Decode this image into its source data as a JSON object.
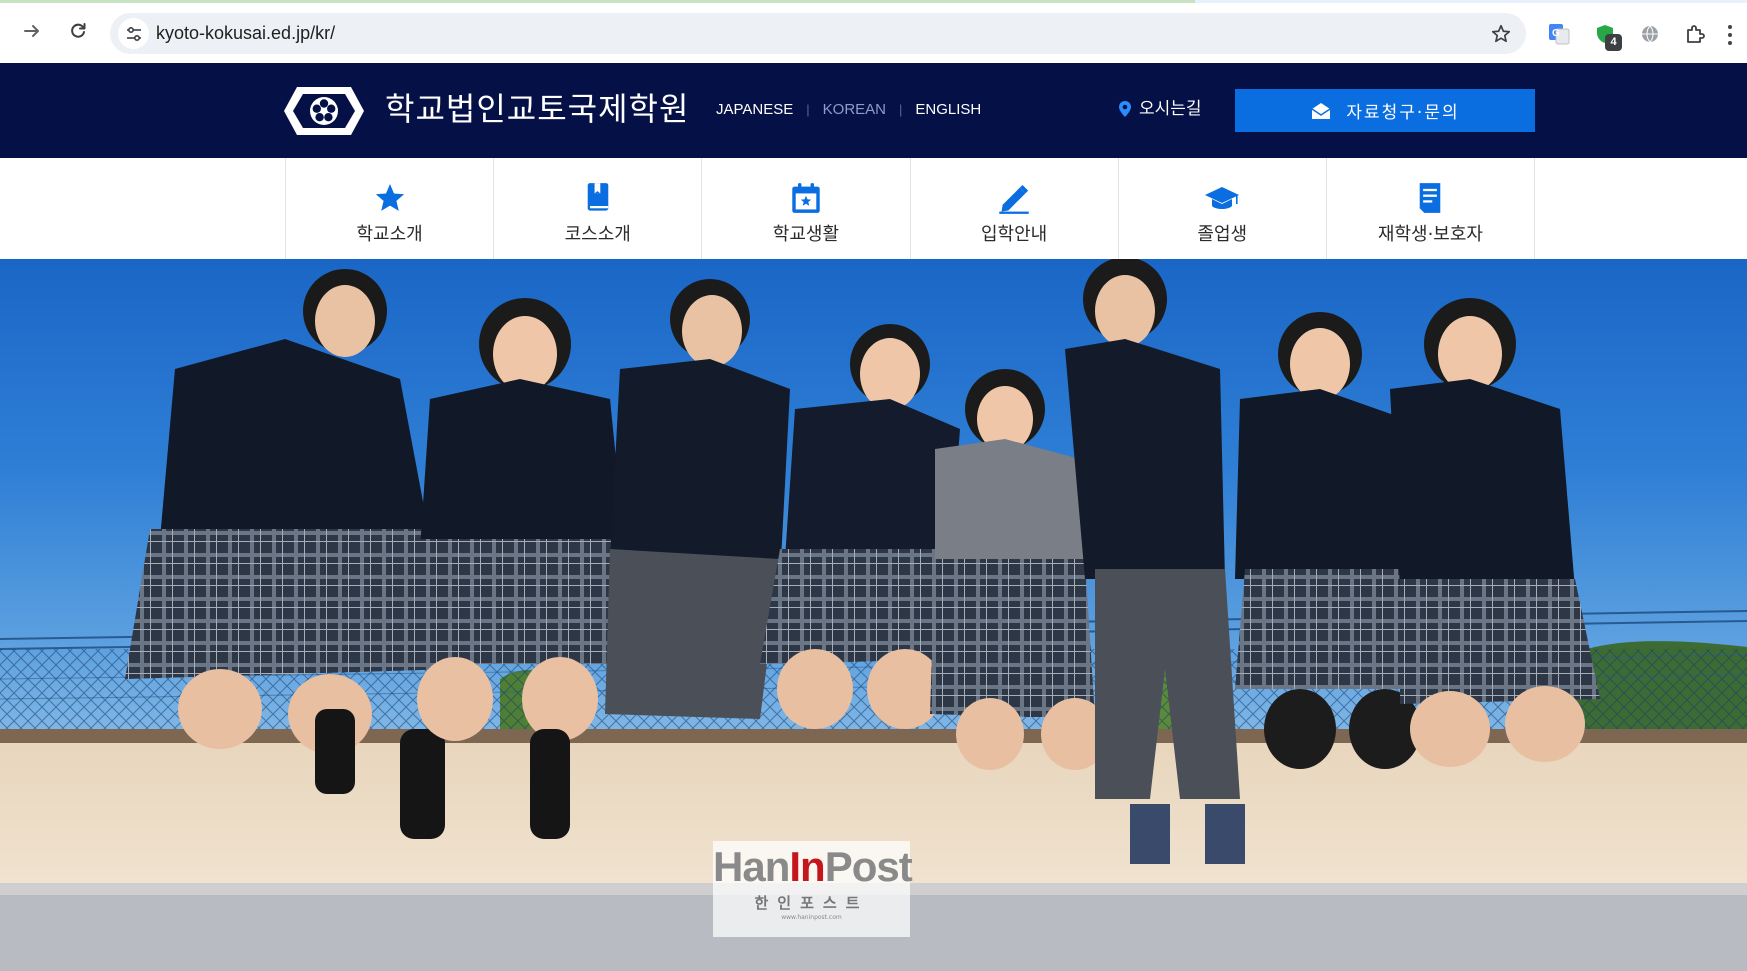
{
  "browser": {
    "url": "kyoto-kokusai.ed.jp/kr/",
    "extensions": [
      {
        "name": "translate-extension-icon"
      },
      {
        "name": "shield-extension-icon",
        "badge": "4"
      },
      {
        "name": "globe-extension-icon"
      },
      {
        "name": "puzzle-extensions-icon"
      }
    ]
  },
  "header": {
    "school_name": "학교법인교토국제학원",
    "languages": [
      "JAPANESE",
      "KOREAN",
      "ENGLISH"
    ],
    "active_language": "KOREAN",
    "access_label": "오시는길",
    "contact_label": "자료청구·문의",
    "colors": {
      "header_bg": "#051146",
      "contact_bg": "#0a6ee0",
      "nav_icon": "#0a6ee0"
    }
  },
  "nav": {
    "items": [
      {
        "label": "학교소개",
        "icon": "star-icon"
      },
      {
        "label": "코스소개",
        "icon": "book-icon"
      },
      {
        "label": "학교생활",
        "icon": "calendar-icon"
      },
      {
        "label": "입학안내",
        "icon": "pencil-icon"
      },
      {
        "label": "졸업생",
        "icon": "graduation-cap-icon"
      },
      {
        "label": "재학생·보호자",
        "icon": "document-icon"
      }
    ]
  },
  "hero": {
    "watermark_main_a": "Han",
    "watermark_main_b": "In",
    "watermark_main_c": "Post",
    "watermark_sub": "한인포스트",
    "watermark_url": "www.haninpost.com"
  }
}
